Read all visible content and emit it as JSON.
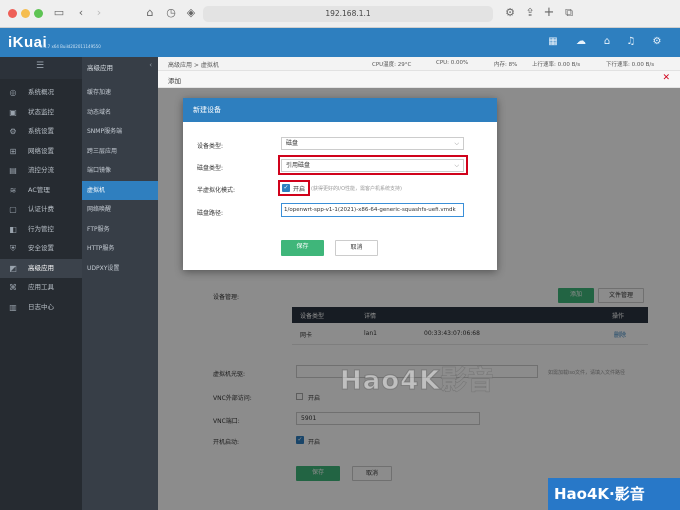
{
  "browser": {
    "url": "192.168.1.1"
  },
  "app": {
    "logo": "iKuai",
    "version": "3.4.7 x64 Build202011149550"
  },
  "header_icons": [
    "grid-icon",
    "cloud-icon",
    "home-icon",
    "bell-icon",
    "settings-icon"
  ],
  "sidebar": {
    "items": [
      {
        "label": "系统概况",
        "icon": "dashboard-icon"
      },
      {
        "label": "状态监控",
        "icon": "monitor-icon"
      },
      {
        "label": "系统设置",
        "icon": "gear-icon"
      },
      {
        "label": "网络设置",
        "icon": "network-icon"
      },
      {
        "label": "流控分流",
        "icon": "flow-icon"
      },
      {
        "label": "AC管理",
        "icon": "ac-icon"
      },
      {
        "label": "认证计费",
        "icon": "auth-icon"
      },
      {
        "label": "行为管控",
        "icon": "behavior-icon"
      },
      {
        "label": "安全设置",
        "icon": "shield-icon"
      },
      {
        "label": "高级应用",
        "icon": "advanced-icon"
      },
      {
        "label": "应用工具",
        "icon": "tools-icon"
      },
      {
        "label": "日志中心",
        "icon": "log-icon"
      }
    ]
  },
  "submenu": {
    "title": "高级应用",
    "items": [
      "缓存加速",
      "动态域名",
      "SNMP服务端",
      "跨三层应用",
      "端口镜像",
      "虚拟机",
      "网络唤醒",
      "FTP服务",
      "HTTP服务",
      "UDPXY设置"
    ]
  },
  "breadcrumb": "高级应用 > 虚拟机",
  "add_label": "添加",
  "status": {
    "cpu_temp": "CPU温度: 29°C",
    "cpu": "CPU: 0.00%",
    "mem": "内存: 8%",
    "up": "上行速率: 0.00 B/s",
    "down": "下行速率: 0.00 B/s"
  },
  "modal": {
    "title": "新建设备",
    "device_type_label": "设备类型:",
    "device_type_value": "磁盘",
    "disk_type_label": "磁盘类型:",
    "disk_type_value": "引用磁盘",
    "paravirt_label": "半虚拟化模式:",
    "paravirt_checkbox": "开启",
    "paravirt_hint": "(获得更好的I/O性能，需客户机系统支持)",
    "disk_path_label": "磁盘路径:",
    "disk_path_value": "1/openwrt-spp-v1-1(2021)-x86-64-generic-squashfs-uefi.vmdk",
    "save": "保存",
    "cancel": "取消"
  },
  "form": {
    "device_mgmt_label": "设备管理:",
    "add_btn": "添加",
    "file_mgmt_btn": "文件管理",
    "table_headers": [
      "设备类型",
      "详情",
      "",
      "操作"
    ],
    "table_rows": [
      [
        "网卡",
        "lan1",
        "00:33:43:07:06:68",
        "删除"
      ]
    ],
    "cdrom_label": "虚拟机光驱:",
    "cdrom_hint": "如需加载iso文件，请填入文件路径",
    "vnc_ext_label": "VNC外部访问:",
    "vnc_ext_value": "开启",
    "vnc_port_label": "VNC端口:",
    "vnc_port_value": "5901",
    "autostart_label": "开机启动:",
    "autostart_value": "开启",
    "save": "保存",
    "cancel": "取消"
  },
  "watermark": {
    "center": "Hao4K影音",
    "corner": "Hao4K·影音"
  },
  "colors": {
    "brand": "#2e7fbf",
    "primary_btn": "#3fb67a",
    "highlight": "#d0021b"
  }
}
